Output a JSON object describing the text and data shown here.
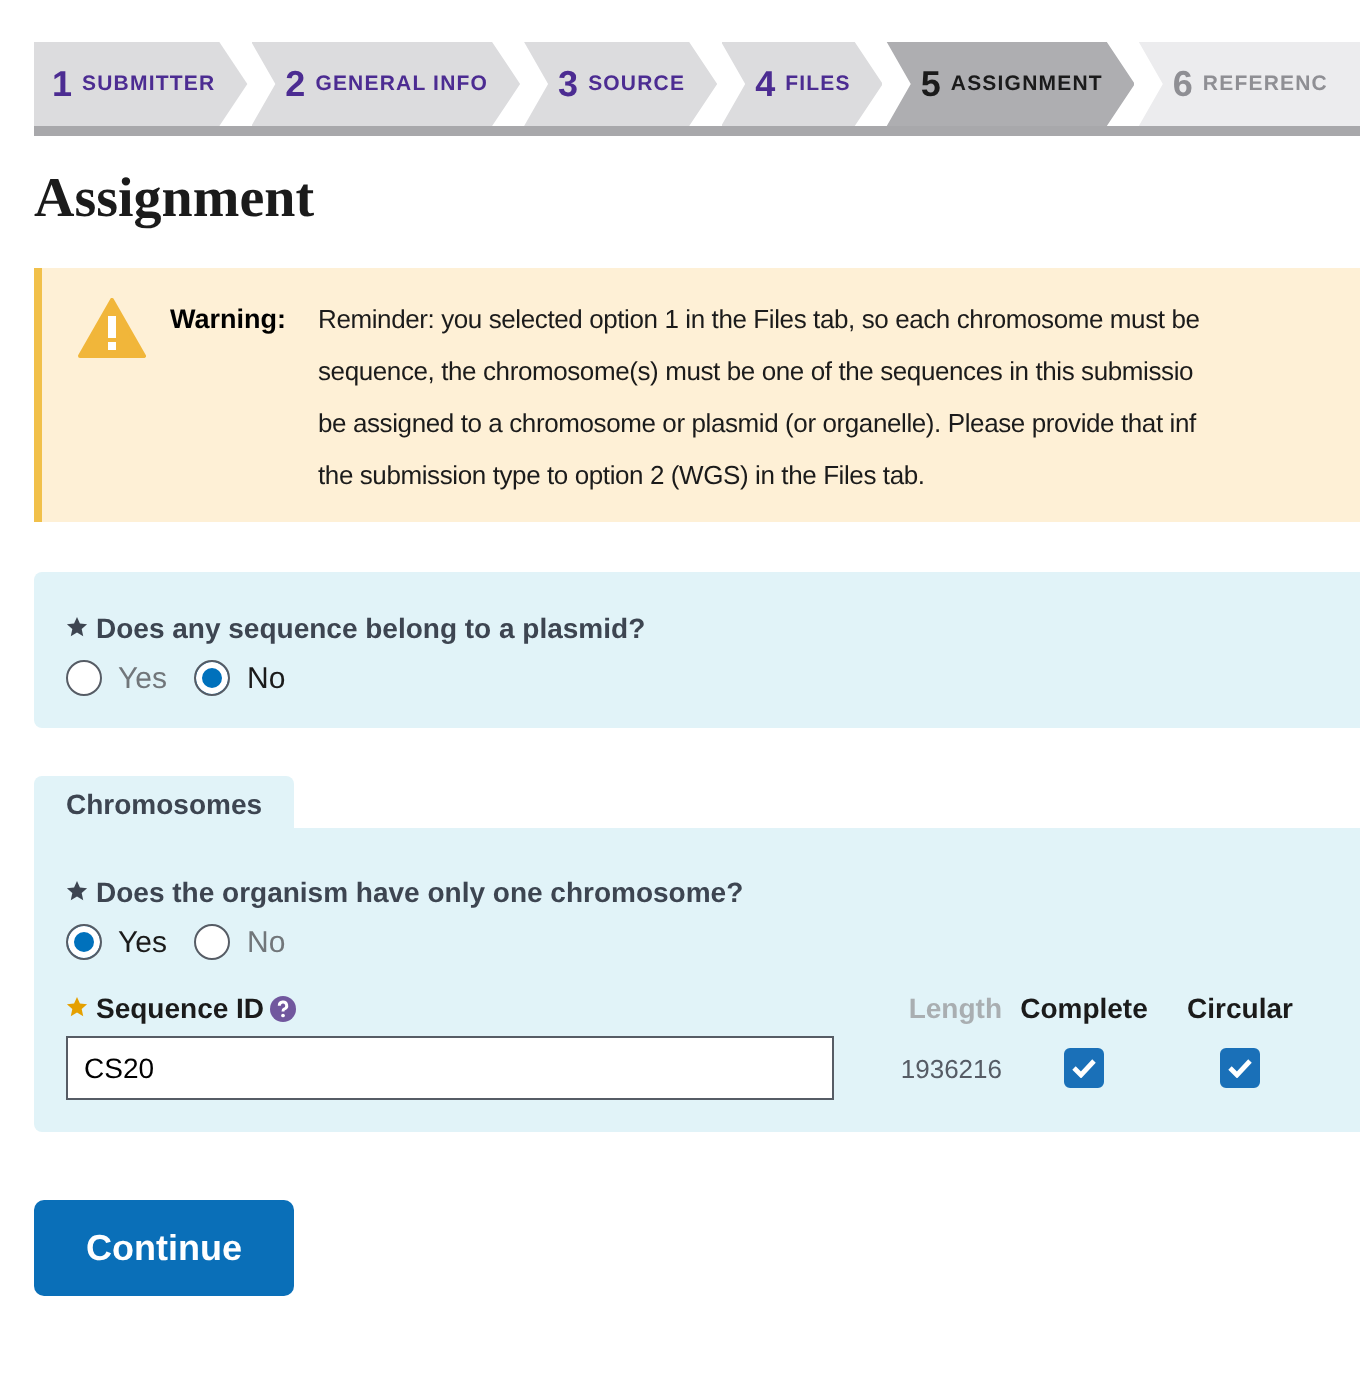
{
  "steps": [
    {
      "number": "1",
      "label": "SUBMITTER",
      "selected": false,
      "disabled": false
    },
    {
      "number": "2",
      "label": "GENERAL INFO",
      "selected": false,
      "disabled": false
    },
    {
      "number": "3",
      "label": "SOURCE",
      "selected": false,
      "disabled": false
    },
    {
      "number": "4",
      "label": "FILES",
      "selected": false,
      "disabled": false
    },
    {
      "number": "5",
      "label": "ASSIGNMENT",
      "selected": true,
      "disabled": false
    },
    {
      "number": "6",
      "label": "REFERENC",
      "selected": false,
      "disabled": true
    }
  ],
  "title": "Assignment",
  "warning": {
    "label": "Warning:",
    "lines": [
      "Reminder: you selected option 1 in the Files tab, so each chromosome must be",
      "sequence, the chromosome(s) must be one of the sequences in this submissio",
      "be assigned to a chromosome or plasmid (or organelle). Please provide that inf",
      "the submission type to option 2 (WGS) in the Files tab."
    ]
  },
  "plasmid_question": {
    "label": "Does any sequence belong to a plasmid?",
    "options": [
      {
        "label": "Yes",
        "selected": false
      },
      {
        "label": "No",
        "selected": true
      }
    ]
  },
  "chromosomes": {
    "tab": "Chromosomes",
    "question": {
      "label": "Does the organism have only one chromosome?",
      "options": [
        {
          "label": "Yes",
          "selected": true
        },
        {
          "label": "No",
          "selected": false
        }
      ]
    },
    "columns": {
      "sequence_id": "Sequence ID",
      "length": "Length",
      "complete": "Complete",
      "circular": "Circular"
    },
    "rows": [
      {
        "sequence_id": "CS20",
        "length": "1936216",
        "complete": true,
        "circular": true
      }
    ]
  },
  "continue_button": "Continue"
}
